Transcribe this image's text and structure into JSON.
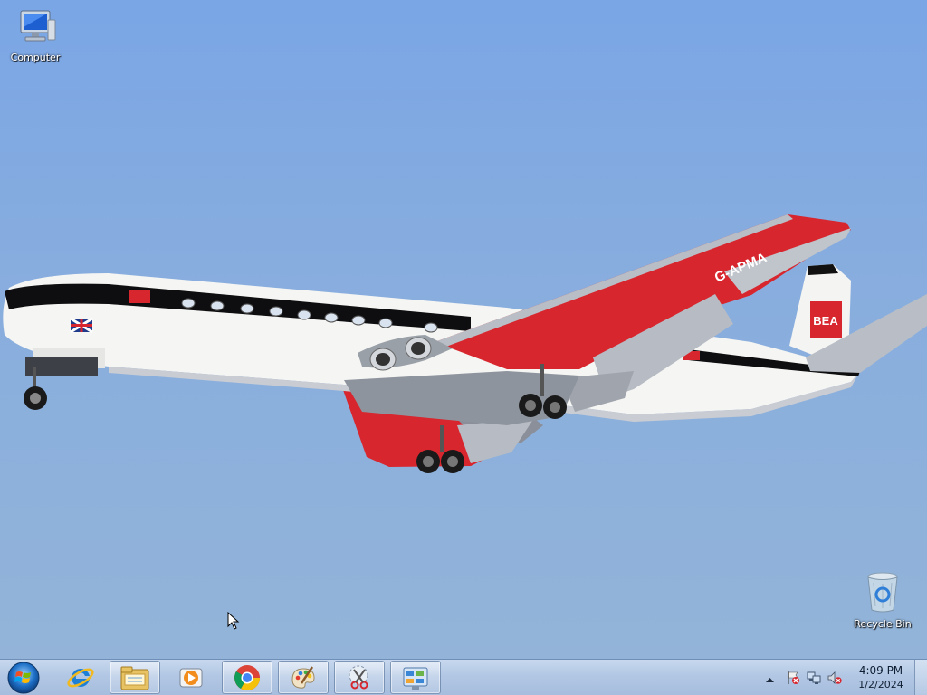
{
  "desktop": {
    "icons": [
      {
        "label": "Computer",
        "icon": "computer-icon"
      },
      {
        "label": "Recycle Bin",
        "icon": "recycle-bin-icon"
      }
    ],
    "wallpaper": {
      "aircraft_registration": "G-APMA",
      "airline_mark": "BEA"
    }
  },
  "taskbar": {
    "start_icon": "windows-start-orb-icon",
    "items": [
      {
        "icon": "internet-explorer-icon",
        "open": false
      },
      {
        "icon": "file-explorer-icon",
        "open": true
      },
      {
        "icon": "media-player-icon",
        "open": false
      },
      {
        "icon": "chrome-icon",
        "open": true
      },
      {
        "icon": "paint-icon",
        "open": true
      },
      {
        "icon": "snipping-tool-icon",
        "open": true
      },
      {
        "icon": "control-panel-icon",
        "open": true
      }
    ]
  },
  "tray": {
    "icons": [
      "show-hidden-icons-arrow",
      "action-center-flag-icon",
      "network-icon",
      "volume-muted-icon"
    ],
    "time": "4:09 PM",
    "date": "1/2/2024"
  },
  "colors": {
    "accent_red": "#d8262e",
    "sky": "#86acdf",
    "taskbar": "#b2c7e4"
  }
}
